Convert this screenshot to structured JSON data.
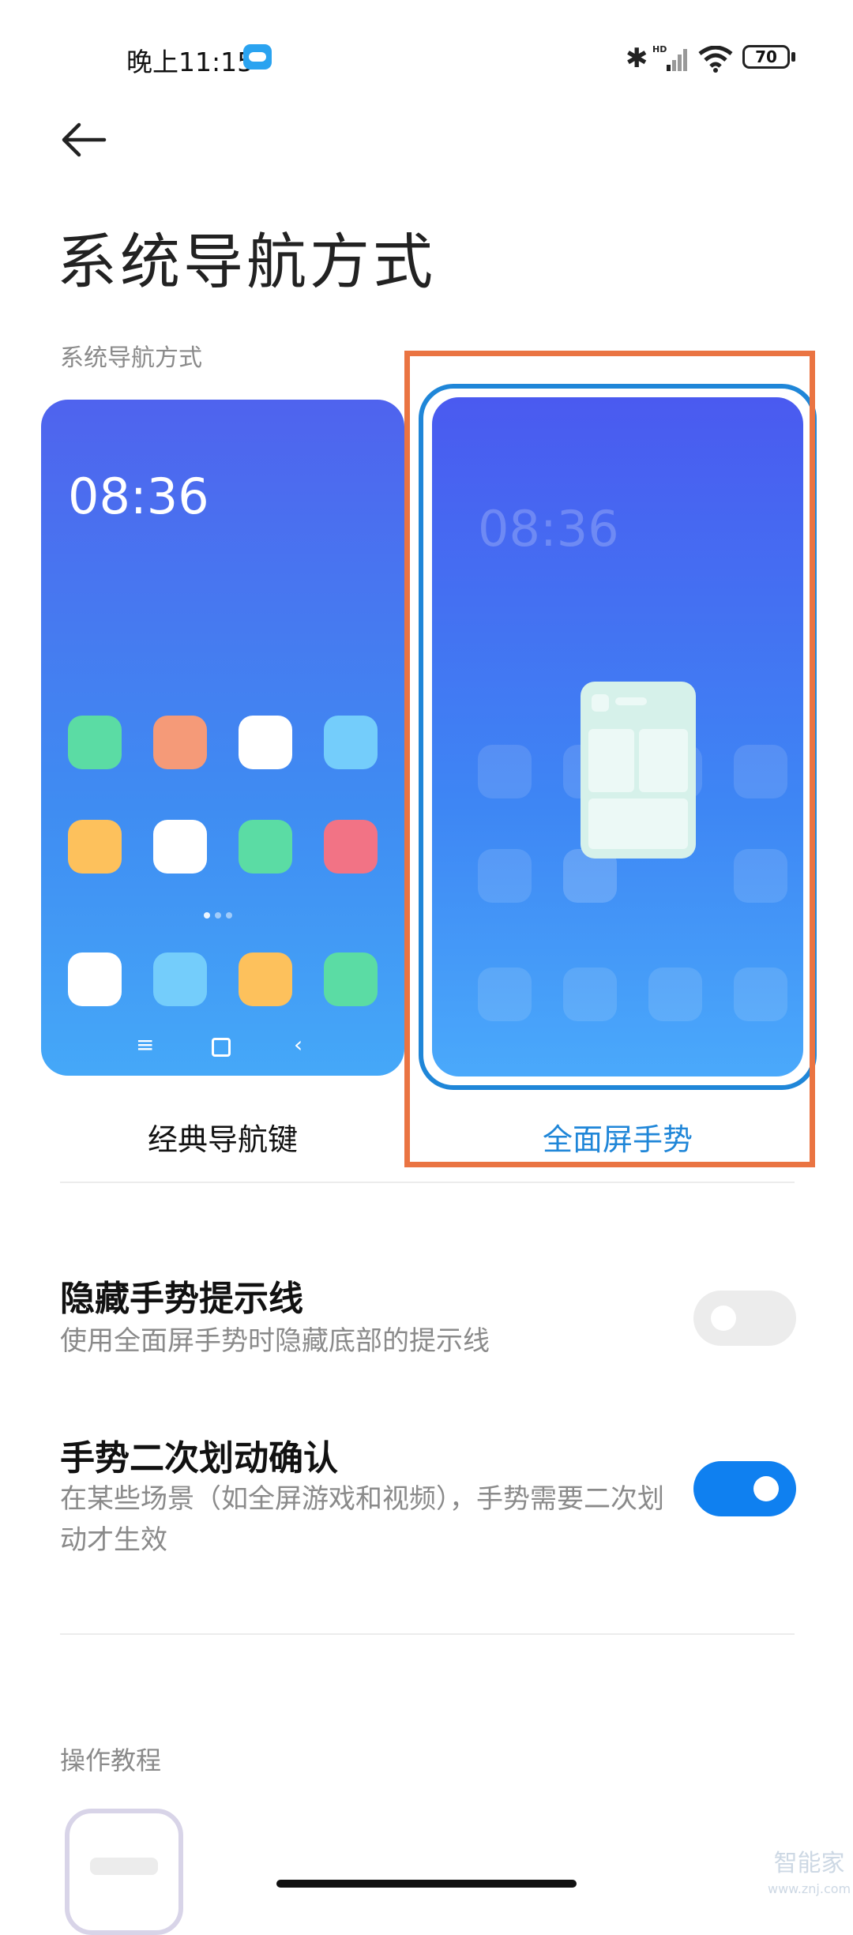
{
  "status_bar": {
    "time": "晚上11:15",
    "icons": [
      "cloud-icon",
      "bluetooth-icon",
      "hd-signal-icon",
      "wifi-icon",
      "battery-icon"
    ],
    "battery": "70"
  },
  "header": {
    "title": "系统导航方式"
  },
  "section": {
    "label": "系统导航方式"
  },
  "options": [
    {
      "label": "经典导航键",
      "clock": "08:36",
      "selected": false
    },
    {
      "label": "全面屏手势",
      "clock": "08:36",
      "selected": true
    }
  ],
  "settings": [
    {
      "title": "隐藏手势提示线",
      "description": "使用全面屏手势时隐藏底部的提示线",
      "enabled": false
    },
    {
      "title": "手势二次划动确认",
      "description": "在某些场景（如全屏游戏和视频），手势需要二次划动才生效",
      "enabled": true
    }
  ],
  "tutorial": {
    "label": "操作教程"
  },
  "watermark": {
    "text": "智能家",
    "url": "www.znj.com"
  },
  "colors": {
    "accent": "#1f86d8",
    "toggle_on": "#0f80f0",
    "highlight": "#ea7442"
  }
}
